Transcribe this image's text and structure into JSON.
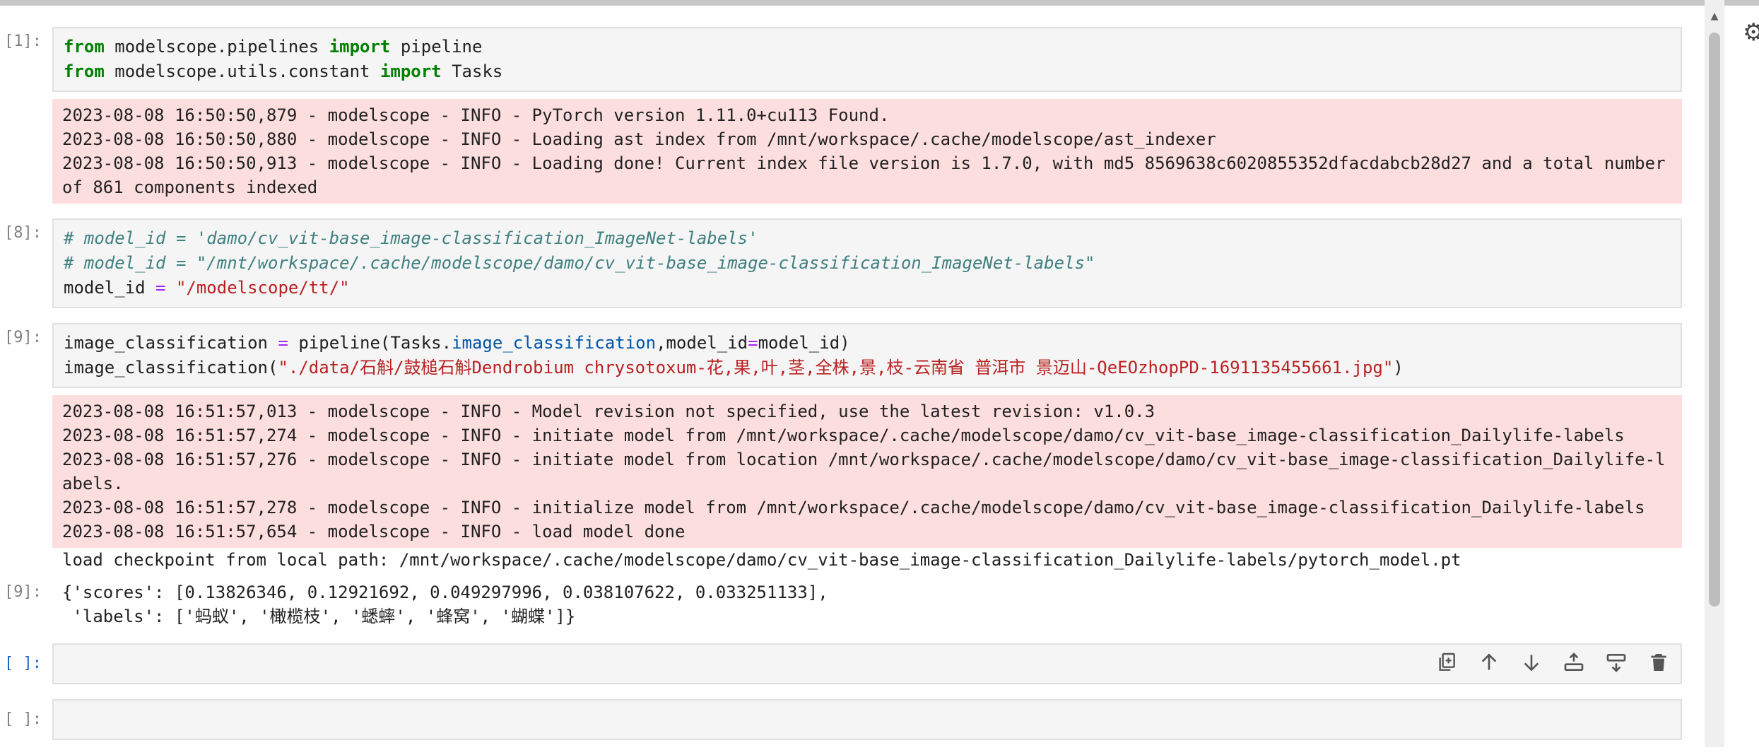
{
  "cells": [
    {
      "prompt": "[1]:",
      "code_lines": [
        [
          {
            "t": "from",
            "c": "kw"
          },
          {
            "t": " modelscope.pipelines ",
            "c": ""
          },
          {
            "t": "import",
            "c": "kw"
          },
          {
            "t": " pipeline",
            "c": ""
          }
        ],
        [
          {
            "t": "from",
            "c": "kw"
          },
          {
            "t": " modelscope.utils.constant ",
            "c": ""
          },
          {
            "t": "import",
            "c": "kw"
          },
          {
            "t": " Tasks",
            "c": ""
          }
        ]
      ],
      "stderr": "2023-08-08 16:50:50,879 - modelscope - INFO - PyTorch version 1.11.0+cu113 Found.\n2023-08-08 16:50:50,880 - modelscope - INFO - Loading ast index from /mnt/workspace/.cache/modelscope/ast_indexer\n2023-08-08 16:50:50,913 - modelscope - INFO - Loading done! Current index file version is 1.7.0, with md5 8569638c6020855352dfacdabcb28d27 and a total number of 861 components indexed"
    },
    {
      "prompt": "[8]:",
      "code_lines": [
        [
          {
            "t": "# model_id = 'damo/cv_vit-base_image-classification_ImageNet-labels'",
            "c": "cm"
          }
        ],
        [
          {
            "t": "# model_id = \"/mnt/workspace/.cache/modelscope/damo/cv_vit-base_image-classification_ImageNet-labels\"",
            "c": "cm"
          }
        ],
        [
          {
            "t": "model_id ",
            "c": ""
          },
          {
            "t": "=",
            "c": "op"
          },
          {
            "t": " ",
            "c": ""
          },
          {
            "t": "\"/modelscope/tt/\"",
            "c": "str"
          }
        ]
      ]
    },
    {
      "prompt": "[9]:",
      "code_lines": [
        [
          {
            "t": "image_classification ",
            "c": ""
          },
          {
            "t": "=",
            "c": "op"
          },
          {
            "t": " pipeline(Tasks.",
            "c": ""
          },
          {
            "t": "image_classification",
            "c": "attr"
          },
          {
            "t": ",model_id",
            "c": ""
          },
          {
            "t": "=",
            "c": "op"
          },
          {
            "t": "model_id)",
            "c": ""
          }
        ],
        [
          {
            "t": "image_classification(",
            "c": ""
          },
          {
            "t": "\"./data/石斛/鼓槌石斛Dendrobium chrysotoxum-花,果,叶,茎,全株,景,枝-云南省 普洱市 景迈山-QeEOzhopPD-1691135455661.jpg\"",
            "c": "str"
          },
          {
            "t": ")",
            "c": ""
          }
        ]
      ],
      "stderr": "2023-08-08 16:51:57,013 - modelscope - INFO - Model revision not specified, use the latest revision: v1.0.3\n2023-08-08 16:51:57,274 - modelscope - INFO - initiate model from /mnt/workspace/.cache/modelscope/damo/cv_vit-base_image-classification_Dailylife-labels\n2023-08-08 16:51:57,276 - modelscope - INFO - initiate model from location /mnt/workspace/.cache/modelscope/damo/cv_vit-base_image-classification_Dailylife-labels.\n2023-08-08 16:51:57,278 - modelscope - INFO - initialize model from /mnt/workspace/.cache/modelscope/damo/cv_vit-base_image-classification_Dailylife-labels\n2023-08-08 16:51:57,654 - modelscope - INFO - load model done",
      "stdout": "load checkpoint from local path: /mnt/workspace/.cache/modelscope/damo/cv_vit-base_image-classification_Dailylife-labels/pytorch_model.pt",
      "result_prompt": "[9]:",
      "result": "{'scores': [0.13826346, 0.12921692, 0.049297996, 0.038107622, 0.033251133],\n 'labels': ['蚂蚁', '橄榄枝', '蟋蟀', '蜂窝', '蝴蝶']}"
    }
  ],
  "empty_cells": [
    {
      "prompt": "[ ]:"
    },
    {
      "prompt": "[ ]:"
    }
  ],
  "toolbar": {
    "icons": [
      "duplicate-icon",
      "move-up-icon",
      "move-down-icon",
      "insert-above-icon",
      "insert-below-icon",
      "delete-icon"
    ]
  },
  "colors": {
    "stderr_bg": "#fddede",
    "code_bg": "#f5f5f5",
    "keyword": "#008000",
    "comment": "#408080",
    "string": "#ba2121",
    "operator": "#aa22ff",
    "prompt_empty": "#1565c0"
  }
}
